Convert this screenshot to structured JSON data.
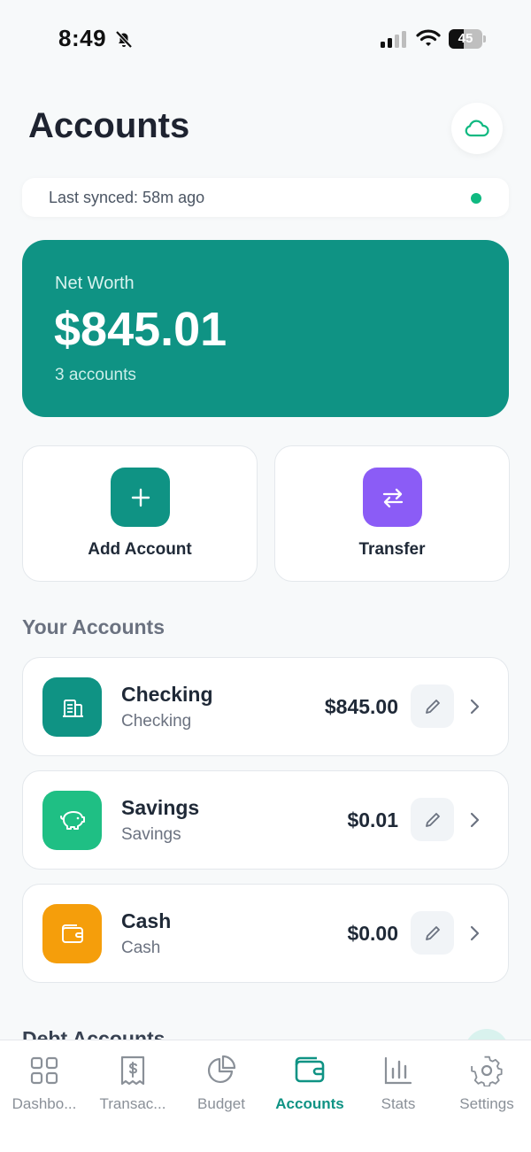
{
  "status_bar": {
    "time": "8:49",
    "battery": "45",
    "battery_level": 0.45
  },
  "header": {
    "title": "Accounts"
  },
  "sync": {
    "text": "Last synced: 58m ago"
  },
  "net_worth": {
    "label": "Net Worth",
    "value": "$845.01",
    "count": "3 accounts"
  },
  "actions": [
    {
      "label": "Add Account",
      "icon": "plus-icon",
      "color": "#0f9384"
    },
    {
      "label": "Transfer",
      "icon": "transfer-icon",
      "color": "#8b5cf6"
    }
  ],
  "section": {
    "your_accounts": "Your Accounts",
    "debt_accounts": "Debt Accounts"
  },
  "accounts": [
    {
      "name": "Checking",
      "type": "Checking",
      "balance": "$845.00",
      "icon": "bank-icon",
      "color": "#0f9384"
    },
    {
      "name": "Savings",
      "type": "Savings",
      "balance": "$0.01",
      "icon": "piggy-bank-icon",
      "color": "#1fbf84"
    },
    {
      "name": "Cash",
      "type": "Cash",
      "balance": "$0.00",
      "icon": "wallet-icon",
      "color": "#f59e0b"
    }
  ],
  "nav": [
    {
      "label": "Dashbo...",
      "icon": "dashboard-icon"
    },
    {
      "label": "Transac...",
      "icon": "receipt-icon"
    },
    {
      "label": "Budget",
      "icon": "pie-chart-icon"
    },
    {
      "label": "Accounts",
      "icon": "wallet-icon",
      "active": true
    },
    {
      "label": "Stats",
      "icon": "bar-chart-icon"
    },
    {
      "label": "Settings",
      "icon": "gear-icon"
    }
  ],
  "colors": {
    "accent": "#0f9384",
    "sync_dot": "#10b981"
  }
}
